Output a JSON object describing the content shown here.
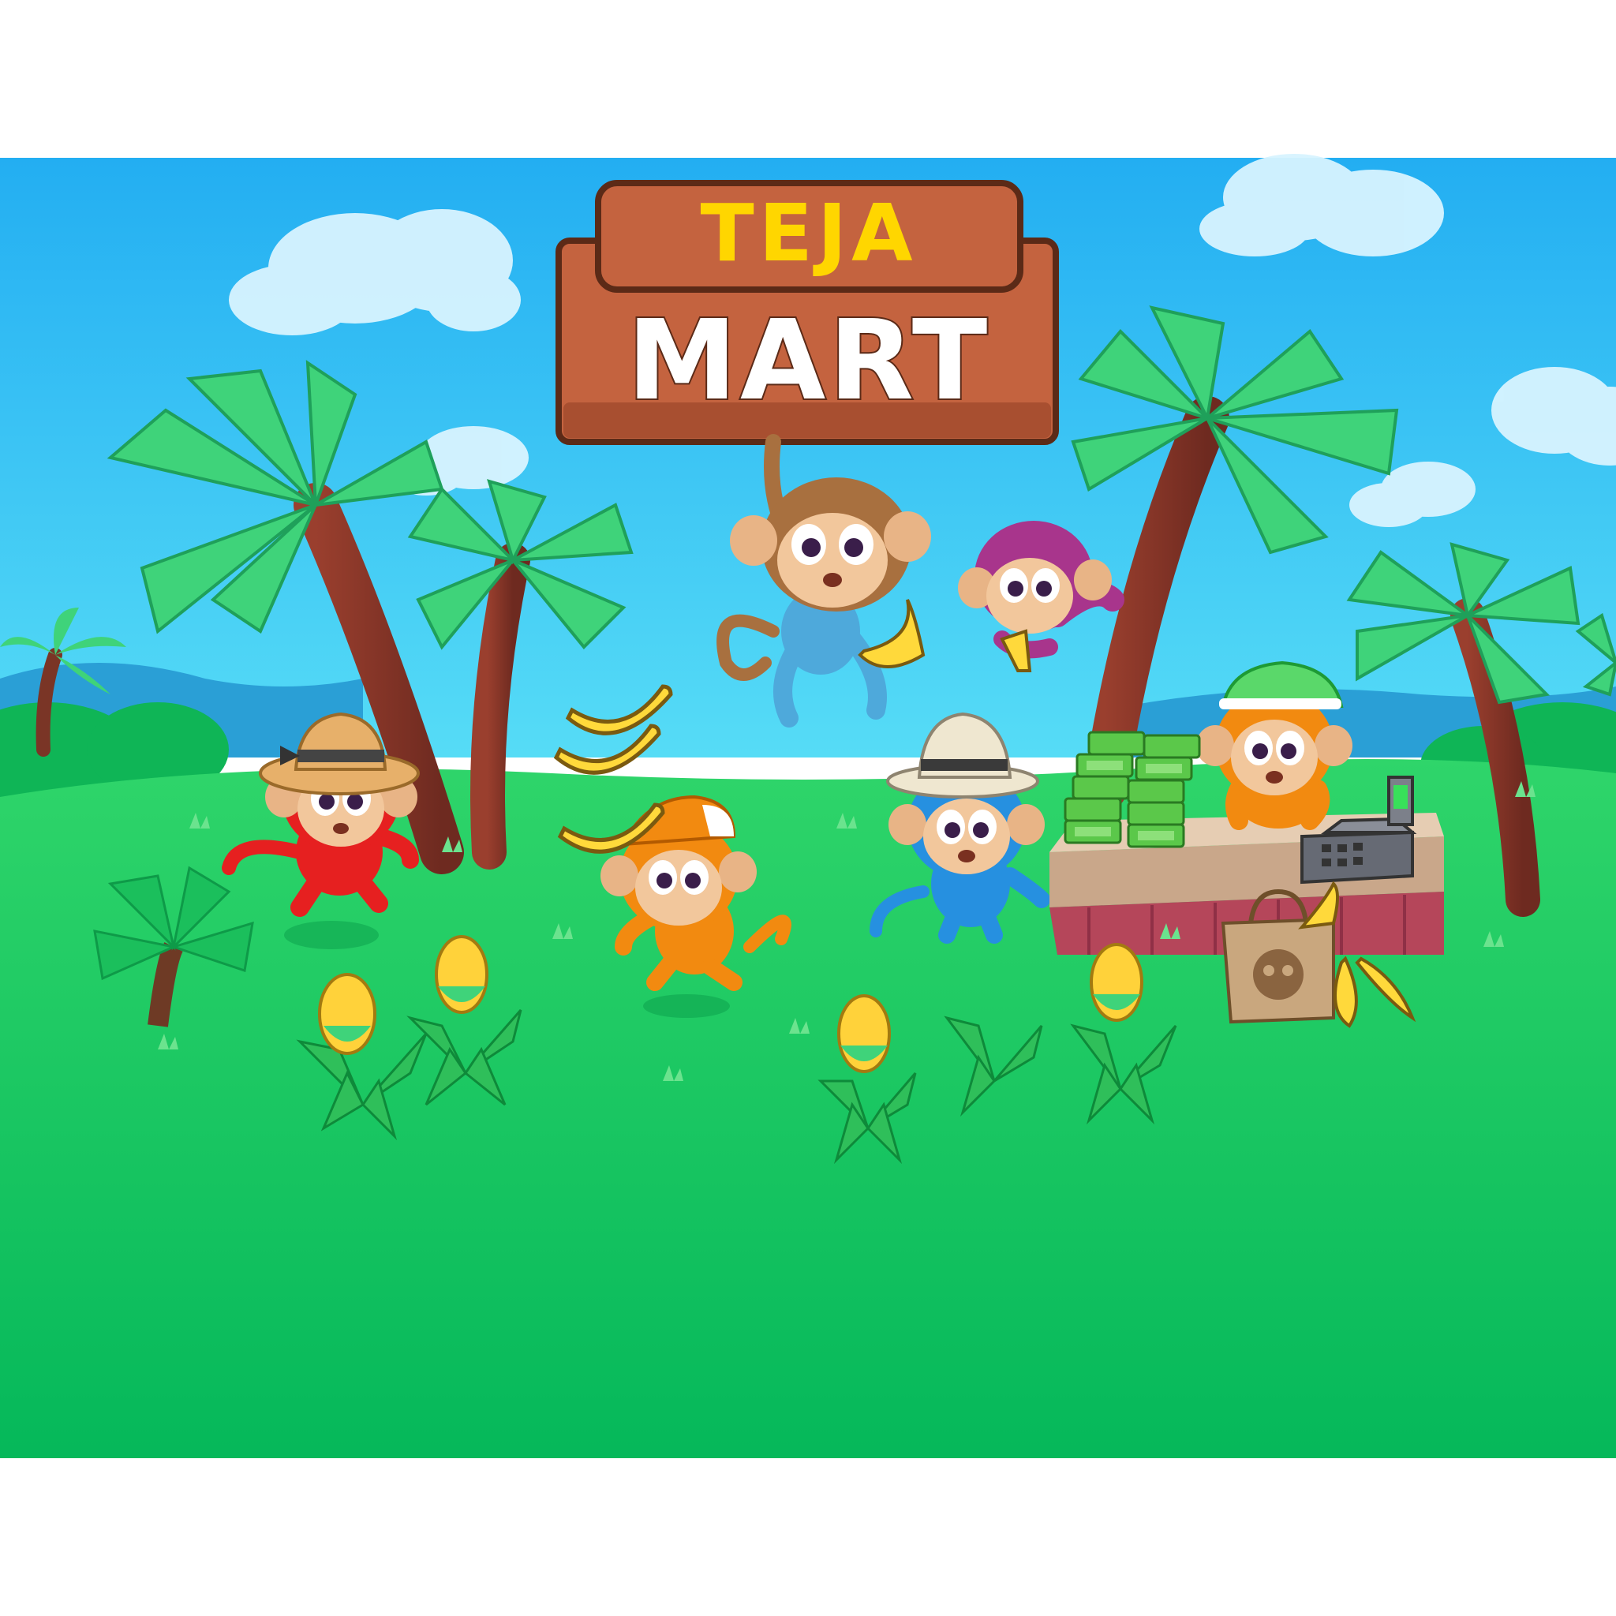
{
  "title": {
    "line1": "TEJA",
    "line2": "MART"
  },
  "colors": {
    "sky_top": "#29B6F6",
    "sky_bottom": "#4FD7F5",
    "grass": "#12C95A",
    "grass_dark": "#08A84A",
    "sign_wood": "#C4633F",
    "sign_wood_dark": "#8E3F22",
    "sign_outline": "#5B2A17",
    "title_yellow": "#FFD600",
    "title_white": "#FFFFFF"
  },
  "icons": {
    "cash": "cash-stack-icon",
    "register": "cash-register-icon",
    "bag": "shopping-bag-icon",
    "banana": "banana-icon",
    "corn": "corn-icon"
  }
}
